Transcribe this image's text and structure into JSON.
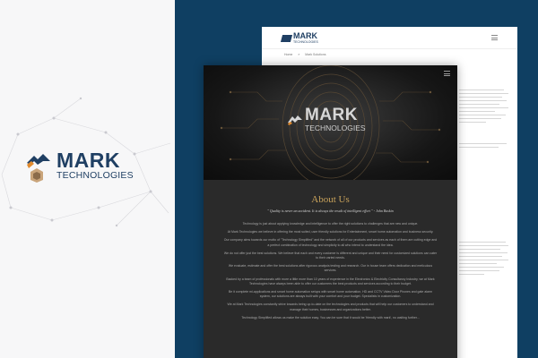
{
  "logo": {
    "title": "MARK",
    "subtitle": "TECHNOLOGIES"
  },
  "back_page": {
    "logo_title": "MARK",
    "logo_subtitle": "TECHNOLOGIES",
    "breadcrumb": [
      "Home",
      "»",
      "Mark Solutions"
    ]
  },
  "front_page": {
    "hero_title": "MARK",
    "hero_subtitle": "TECHNOLOGIES",
    "about_title": "About Us",
    "about_quote": "\" Quality is never an accident. It is always the result of intelligent effort \" - John Ruskin",
    "paragraphs": [
      "Technology is just about applying knowledge and intelligence to offer the right solutions to challenges that are new and unique.",
      "At Mark Technologies we believe in offering the most suited, user friendly solutions for Entertainment, smart home automation and business security.",
      "Our company alms towards our motto of \"Technology Simplified\" and the network of all of our products and services as each of them are cutting edge and a perfect combination of technology and simplicity to all who intend to understand the idea.",
      "We do not offer just the best solutions. We believe that each and every customer is different and unique and their need for customized solutions can cater to their varied needs.",
      "We evaluate, estimate and offer the best solutions after rigorous analysis testing and research. Our in house team offers dedication and meticulous services.",
      "Backed by a team of professionals with more a little more than 10 years of experience in the Electronics & Electricity Consultancy Industry, we at Mark Technologies have always been able to offer our customers the best products and services according to their budget.",
      "Be it complete mi-applications and smart home automation setups with smart home automation, HD and CCTV Video Door Phones and gate alarm system, our solutions are always built with your comfort and your budget. Specialists in customization.",
      "We at Mark Technologies constantly strive towards being up-to-date on the technologies and products that will help our customers to understand and manage their homes, businesses and organizations better.",
      "Technology Simplified allows us make the solution easy. You can be sure that it would be 'friendly with mark', no waiting further..."
    ]
  },
  "colors": {
    "panel_blue": "#0f3f62",
    "brand_blue": "#1f3f63",
    "accent_orange": "#e08a2e",
    "about_gold": "#c7a15a"
  }
}
